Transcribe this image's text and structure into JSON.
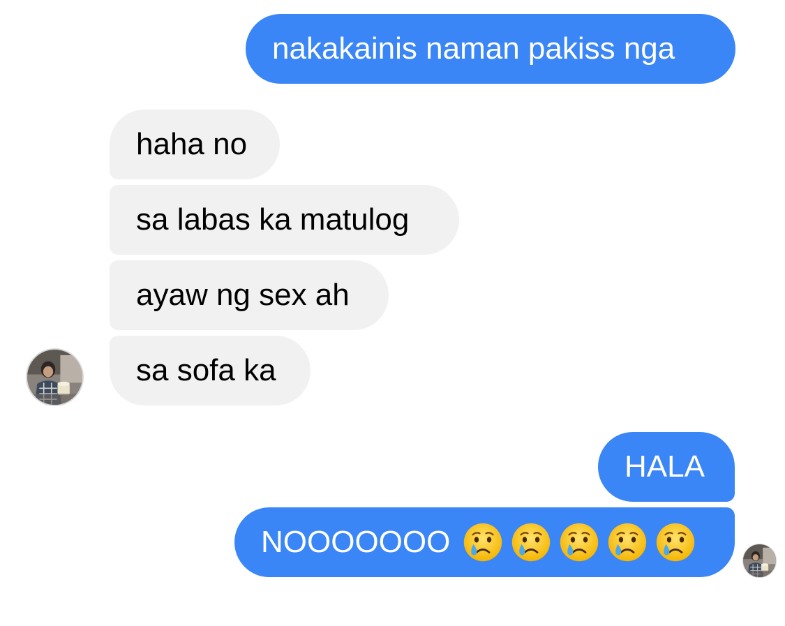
{
  "conversation": {
    "messages": [
      {
        "sender": "me",
        "text": "nakakainis naman pakiss nga"
      },
      {
        "sender": "them",
        "text": "haha no"
      },
      {
        "sender": "them",
        "text": "sa labas ka matulog"
      },
      {
        "sender": "them",
        "text": "ayaw ng sex ah"
      },
      {
        "sender": "them",
        "text": "sa sofa ka"
      },
      {
        "sender": "me",
        "text": "HALA"
      },
      {
        "sender": "me",
        "text": "NOOOOOOO",
        "emoji": [
          "crying-face",
          "crying-face",
          "crying-face",
          "crying-face",
          "crying-face"
        ]
      }
    ],
    "colors": {
      "outgoing_bubble": "#3a86f7",
      "incoming_bubble": "#f1f1f2",
      "outgoing_text": "#ffffff",
      "incoming_text": "#000000"
    }
  }
}
